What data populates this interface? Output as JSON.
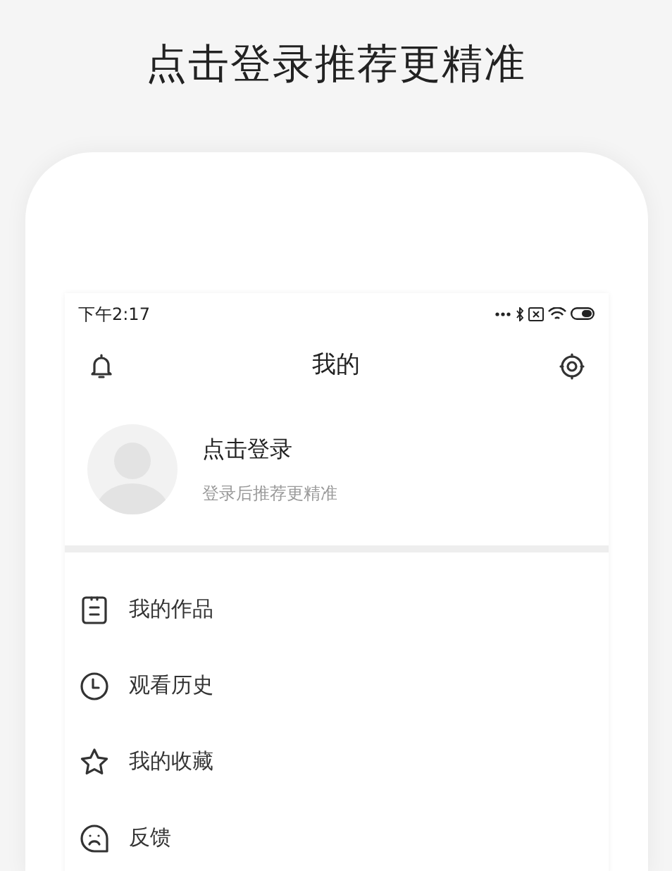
{
  "headline": "点击登录推荐更精准",
  "status_bar": {
    "time": "下午2:17"
  },
  "header": {
    "title": "我的"
  },
  "profile": {
    "name": "点击登录",
    "subtitle": "登录后推荐更精准"
  },
  "menu": [
    {
      "label": "我的作品",
      "kind": "works"
    },
    {
      "label": "观看历史",
      "kind": "history"
    },
    {
      "label": "我的收藏",
      "kind": "favorites"
    },
    {
      "label": "反馈",
      "kind": "feedback"
    }
  ]
}
